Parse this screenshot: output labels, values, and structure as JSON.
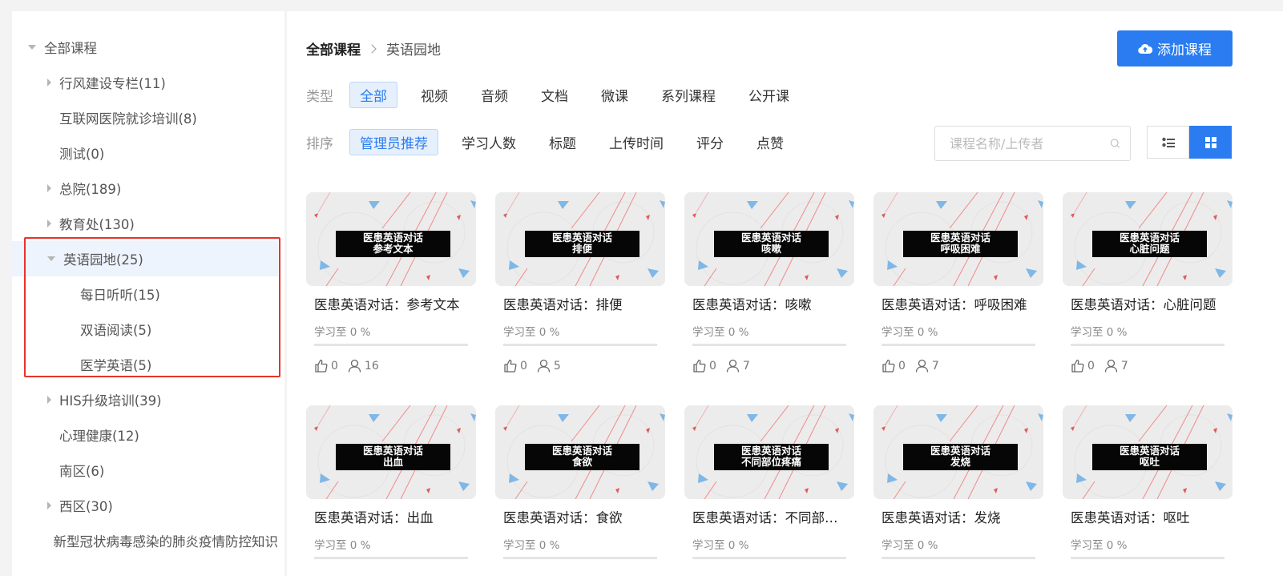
{
  "sidebar": {
    "items": [
      {
        "label": "全部课程",
        "level": 0,
        "arrow": "down"
      },
      {
        "label": "行风建设专栏(11)",
        "level": 1,
        "arrow": "right"
      },
      {
        "label": "互联网医院就诊培训(8)",
        "level": 1,
        "arrow": "none"
      },
      {
        "label": "测试(0)",
        "level": 1,
        "arrow": "none"
      },
      {
        "label": "总院(189)",
        "level": 1,
        "arrow": "right"
      },
      {
        "label": "教育处(130)",
        "level": 1,
        "arrow": "right"
      },
      {
        "label": "英语园地(25)",
        "level": 1,
        "arrow": "down",
        "active": true
      },
      {
        "label": "每日听听(15)",
        "level": 2,
        "arrow": "none"
      },
      {
        "label": "双语阅读(5)",
        "level": 2,
        "arrow": "none"
      },
      {
        "label": "医学英语(5)",
        "level": 2,
        "arrow": "none"
      },
      {
        "label": "HIS升级培训(39)",
        "level": 1,
        "arrow": "right"
      },
      {
        "label": "心理健康(12)",
        "level": 1,
        "arrow": "none"
      },
      {
        "label": "南区(6)",
        "level": 1,
        "arrow": "none"
      },
      {
        "label": "西区(30)",
        "level": 1,
        "arrow": "right"
      },
      {
        "label": "新型冠状病毒感染的肺炎疫情防控知识",
        "level": 1,
        "arrow": "none"
      }
    ]
  },
  "breadcrumb": {
    "root": "全部课程",
    "current": "英语园地"
  },
  "add_button": {
    "label": "添加课程"
  },
  "filters": {
    "type": {
      "label": "类型",
      "options": [
        "全部",
        "视频",
        "音频",
        "文档",
        "微课",
        "系列课程",
        "公开课"
      ],
      "selected": 0
    },
    "sort": {
      "label": "排序",
      "options": [
        "管理员推荐",
        "学习人数",
        "标题",
        "上传时间",
        "评分",
        "点赞"
      ],
      "selected": 0
    }
  },
  "search": {
    "placeholder": "课程名称/上传者",
    "value": ""
  },
  "view": {
    "mode": "grid"
  },
  "colors": {
    "accent": "#2a7cf0",
    "highlight": "#e8332b"
  },
  "courses": [
    {
      "thumb_line1": "医患英语对话",
      "thumb_line2": "参考文本",
      "title": "医患英语对话：参考文本",
      "progress_text": "学习至 0 %",
      "progress": 0,
      "likes": "0",
      "learners": "16"
    },
    {
      "thumb_line1": "医患英语对话",
      "thumb_line2": "排便",
      "title": "医患英语对话：排便",
      "progress_text": "学习至 0 %",
      "progress": 0,
      "likes": "0",
      "learners": "5"
    },
    {
      "thumb_line1": "医患英语对话",
      "thumb_line2": "咳嗽",
      "title": "医患英语对话：咳嗽",
      "progress_text": "学习至 0 %",
      "progress": 0,
      "likes": "0",
      "learners": "7"
    },
    {
      "thumb_line1": "医患英语对话",
      "thumb_line2": "呼吸困难",
      "title": "医患英语对话：呼吸困难",
      "progress_text": "学习至 0 %",
      "progress": 0,
      "likes": "0",
      "learners": "7"
    },
    {
      "thumb_line1": "医患英语对话",
      "thumb_line2": "心脏问题",
      "title": "医患英语对话：心脏问题",
      "progress_text": "学习至 0 %",
      "progress": 0,
      "likes": "0",
      "learners": "7"
    },
    {
      "thumb_line1": "医患英语对话",
      "thumb_line2": "出血",
      "title": "医患英语对话：出血",
      "progress_text": "学习至 0 %",
      "progress": 0
    },
    {
      "thumb_line1": "医患英语对话",
      "thumb_line2": "食欲",
      "title": "医患英语对话：食欲",
      "progress_text": "学习至 0 %",
      "progress": 0
    },
    {
      "thumb_line1": "医患英语对话",
      "thumb_line2": "不同部位疼痛",
      "title": "医患英语对话：不同部位疼痛",
      "progress_text": "学习至 0 %",
      "progress": 0
    },
    {
      "thumb_line1": "医患英语对话",
      "thumb_line2": "发烧",
      "title": "医患英语对话：发烧",
      "progress_text": "学习至 0 %",
      "progress": 0
    },
    {
      "thumb_line1": "医患英语对话",
      "thumb_line2": "呕吐",
      "title": "医患英语对话：呕吐",
      "progress_text": "学习至 0 %",
      "progress": 0
    }
  ]
}
